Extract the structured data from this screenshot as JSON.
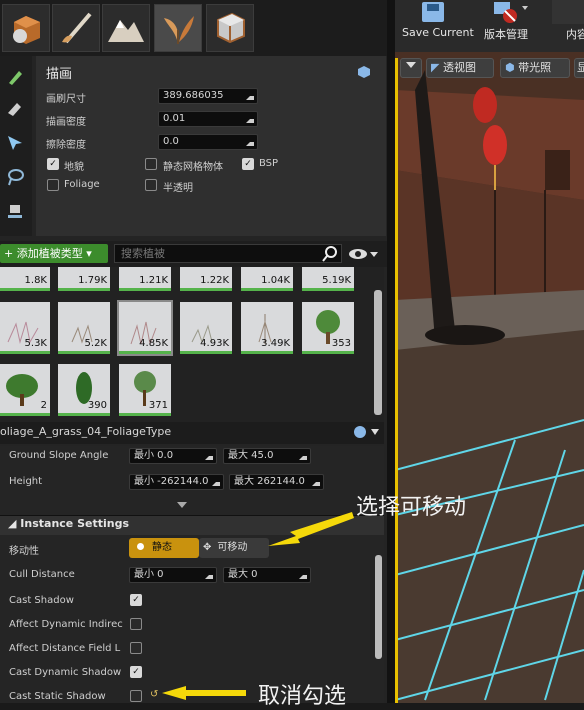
{
  "modes": [
    {
      "icon": "place-mode-icon",
      "active": false
    },
    {
      "icon": "paint-mode-icon",
      "active": false
    },
    {
      "icon": "landscape-mode-icon",
      "active": false
    },
    {
      "icon": "foliage-mode-icon",
      "active": true
    },
    {
      "icon": "geometry-mode-icon",
      "active": false
    }
  ],
  "paint": {
    "title": "描画",
    "brush_size_label": "画刷尺寸",
    "brush_size": "389.686035",
    "paint_density_label": "描画密度",
    "paint_density": "0.01",
    "erase_density_label": "擦除密度",
    "erase_density": "0.0",
    "filters": [
      {
        "label": "地貌",
        "checked": true
      },
      {
        "label": "静态网格物体",
        "checked": false
      },
      {
        "label": "BSP",
        "checked": true
      },
      {
        "label": "Foliage",
        "checked": false
      },
      {
        "label": "半透明",
        "checked": false
      }
    ]
  },
  "foliage_bar": {
    "add_label": "+ 添加植被类型 ▾",
    "search_placeholder": "搜索植被"
  },
  "thumbs_row0": [
    "1.8K",
    "1.79K",
    "1.21K",
    "1.22K",
    "1.04K",
    "5.19K"
  ],
  "thumbs_row1": [
    "5.3K",
    "5.2K",
    "4.85K",
    "4.93K",
    "3.49K",
    "353"
  ],
  "thumbs_row2": [
    "2",
    "390",
    "371"
  ],
  "selected_type": "oliage_A_grass_04_FoliageType",
  "details": {
    "ground_slope_label": "Ground Slope Angle",
    "ground_slope_min": "最小  0.0",
    "ground_slope_max": "最大  45.0",
    "height_label": "Height",
    "height_min": "最小  -262144.0",
    "height_max": "最大  262144.0",
    "section_title": "Instance Settings",
    "mobility_label": "移动性",
    "mobility_static": "静态",
    "mobility_movable": "可移动",
    "cull_label": "Cull Distance",
    "cull_min": "最小  0",
    "cull_max": "最大  0",
    "cast_shadow_label": "Cast Shadow",
    "cast_shadow": true,
    "affect_indirect_label": "Affect Dynamic Indirec",
    "affect_indirect": false,
    "affect_df_label": "Affect Distance Field L",
    "affect_df": false,
    "cast_dyn_label": "Cast Dynamic Shadow",
    "cast_dyn": true,
    "cast_static_label": "Cast Static Shadow",
    "cast_static": false
  },
  "annotations": {
    "select_movable": "选择可移动",
    "uncheck": "取消勾选",
    "arrow_color": "#f5d90a"
  },
  "viewport": {
    "save_current": "Save Current",
    "version_control": "版本管理",
    "content": "内容",
    "perspective": "透视图",
    "lit": "带光照",
    "extra": "显"
  },
  "colors": {
    "accent_green": "#55b34b",
    "static_toggle": "#c9920e",
    "grid_cyan": "#5fd6e8",
    "selection_yellow": "#e8c000"
  }
}
